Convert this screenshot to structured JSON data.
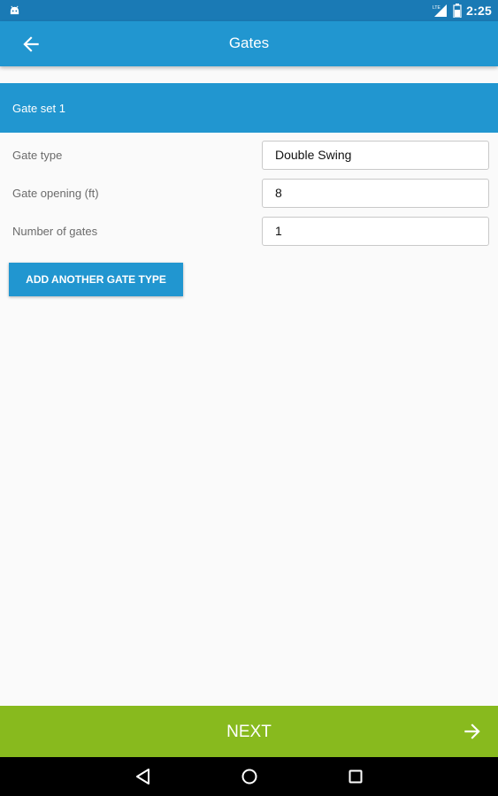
{
  "status_bar": {
    "time": "2:25",
    "icons": [
      "android-icon",
      "signal-icon",
      "battery-icon"
    ]
  },
  "app_bar": {
    "title": "Gates",
    "back_icon": "arrow-left-icon"
  },
  "section": {
    "title": "Gate set 1"
  },
  "form": {
    "gate_type": {
      "label": "Gate type",
      "value": "Double Swing"
    },
    "gate_opening": {
      "label": "Gate opening (ft)",
      "value": "8"
    },
    "number_of_gates": {
      "label": "Number of gates",
      "value": "1"
    }
  },
  "add_button": {
    "label": "ADD ANOTHER GATE TYPE"
  },
  "next_bar": {
    "label": "NEXT",
    "icon": "arrow-right-icon"
  },
  "nav_bar": {
    "icons": [
      "back-triangle-icon",
      "home-circle-icon",
      "recents-square-icon"
    ]
  },
  "colors": {
    "primary": "#2196d0",
    "status_bar": "#1a7ab5",
    "next_bar": "#88ba1e",
    "background": "#fafafa"
  }
}
